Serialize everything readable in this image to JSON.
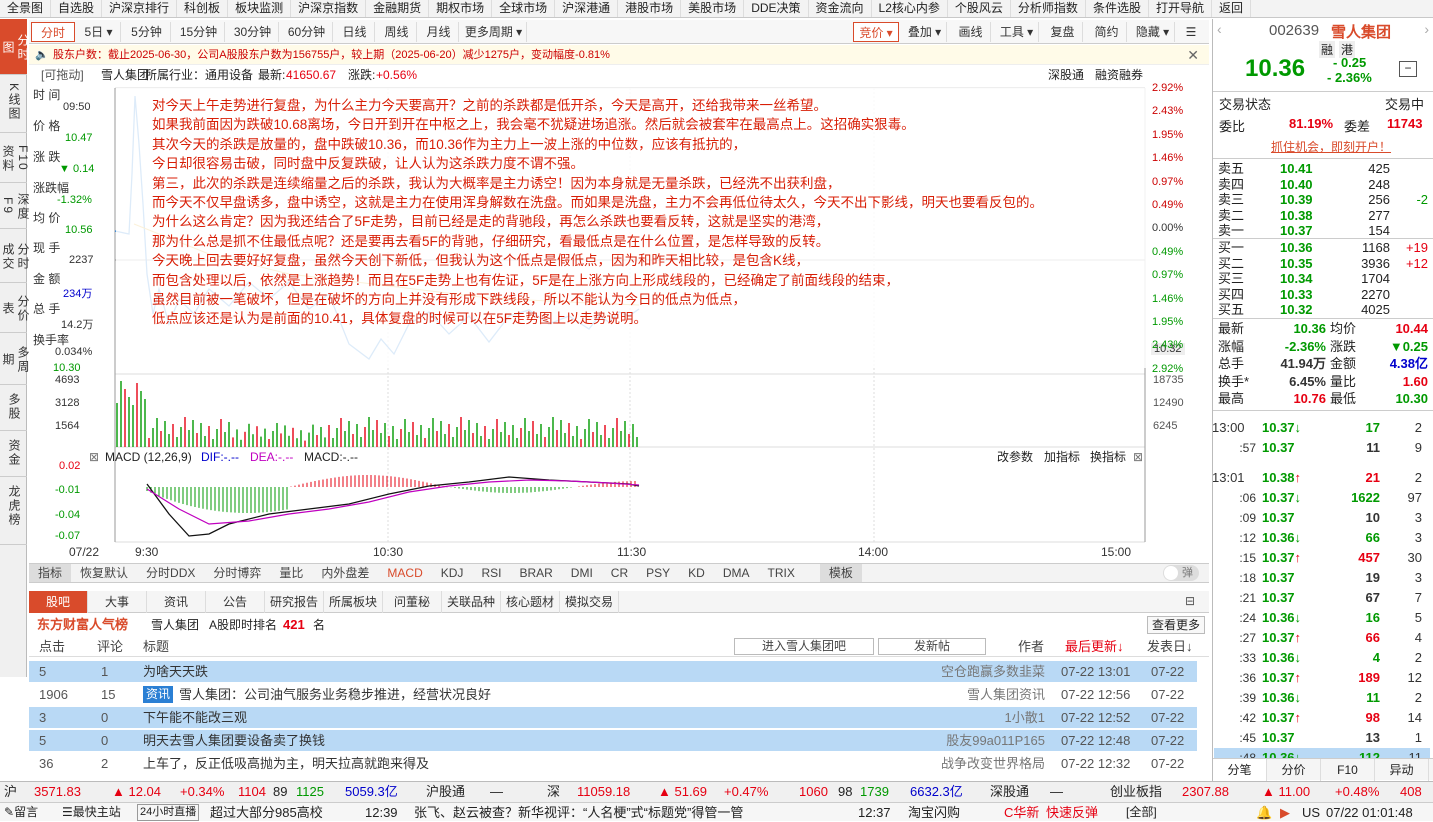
{
  "menu": [
    "全景图",
    "自选股",
    "沪深京排行",
    "科创板",
    "板块监测",
    "沪深京指数",
    "金融期货",
    "期权市场",
    "全球市场",
    "沪深港通",
    "港股市场",
    "美股市场",
    "DDE决策",
    "资金流向",
    "L2核心内参",
    "个股风云",
    "分析师指数",
    "条件选股",
    "打开导航",
    "返回"
  ],
  "left_tabs": [
    "分时图",
    "K线图",
    "F10资料",
    "深度F9",
    "分时成交",
    "分价表",
    "多周期",
    "多股",
    "资金",
    "龙虎榜"
  ],
  "toolbar": {
    "tabs": [
      "分时",
      "5日",
      "5分钟",
      "15分钟",
      "30分钟",
      "60分钟",
      "日线",
      "周线",
      "月线",
      "更多周期"
    ],
    "right": [
      "竞价",
      "叠加",
      "画线",
      "工具",
      "复盘",
      "简约",
      "隐藏"
    ]
  },
  "notice": "股东户数：截止2025-06-30，公司A股股东户数为156755户，较上期（2025-06-20）减少1275户，变动幅度-0.81%",
  "info": {
    "drag": "[可拖动]",
    "name": "雪人集团",
    "industry": "所属行业：通用设备",
    "latest_label": "最新:",
    "latest": "41650.67",
    "chg_label": "涨跌:",
    "chg": "+0.56%",
    "links": [
      "深股通",
      "融资融券"
    ]
  },
  "left_labels": {
    "time": "时 间",
    "time_v": "09:50",
    "price": "价 格",
    "price_v": "10.47",
    "chg": "涨 跌",
    "chg_v": "▼ 0.14",
    "pct": "涨跌幅",
    "pct_v": "-1.32%",
    "avg": "均 价",
    "avg_v": "10.56",
    "vol": "现 手",
    "vol_v": "2237",
    "amt": "金 额",
    "amt_v": "234万",
    "total": "总 手",
    "total_v": "14.2万",
    "turn": "换手率",
    "turn_v": "0.034%",
    "low_v": "10.30"
  },
  "price_axis": [
    "2.92%",
    "2.43%",
    "1.95%",
    "1.46%",
    "0.97%",
    "0.49%",
    "0.00%",
    "0.49%",
    "0.97%",
    "1.46%",
    "1.95%",
    "2.43%",
    "2.92%"
  ],
  "price_right": "10.32",
  "vol_axis_left": [
    "4693",
    "3128",
    "1564"
  ],
  "vol_axis_right": [
    "18735",
    "12490",
    "6245"
  ],
  "macd": {
    "label": "MACD (12,26,9)",
    "dif": "DIF:-.--",
    "dea": "DEA:-.--",
    "macd": "MACD:-.--",
    "actions": [
      "改参数",
      "加指标",
      "换指标"
    ],
    "axis": [
      "0.02",
      "-0.01",
      "-0.04",
      "-0.07"
    ]
  },
  "time_axis": [
    "07/22",
    "9:30",
    "10:30",
    "11:30",
    "14:00",
    "15:00"
  ],
  "annotation": [
    "对今天上午走势进行复盘，为什么主力今天要高开？之前的杀跌都是低开杀，今天是高开，还给我带来一丝希望。",
    "如果我前面因为跌破10.68离场，今日开到开在中枢之上，我会毫不犹疑进场追涨。然后就会被套牢在最高点上。这招确实狠毒。",
    "其次今天的杀跌是放量的，盘中跌破10.36，而10.36作为主力上一波上涨的中位数，应该有抵抗的，",
    "今日却很容易击破，同时盘中反复跌破，让人认为这杀跌力度不谓不强。",
    "第三，此次的杀跌是连续缩量之后的杀跌，我认为大概率是主力诱空！因为本身就是无量杀跌，已经洗不出获利盘，",
    "而今天不仅早盘诱多，盘中诱空，这就是主力在使用浑身解数在洗盘。而如果是洗盘，主力不会再低位待太久，今天不出下影线，明天也要看反包的。",
    "为什么这么肯定？因为我还结合了5F走势，目前已经是走的背驰段，再怎么杀跌也要看反转，这就是坚实的港湾，",
    "那为什么总是抓不住最低点呢？还是要再去看5F的背驰，仔细研究，看最低点是在什么位置，是怎样导致的反转。",
    "今天晚上回去要好好复盘，虽然今天创下新低，但我认为这个低点是假低点，因为和昨天相比较，是包含K线，",
    "而包含处理以后，依然是上涨趋势！而且在5F走势上也有佐证，5F是在上涨方向上形成线段的，已经确定了前面线段的结束，",
    "虽然目前被一笔破坏，但是在破坏的方向上并没有形成下跌线段，所以不能认为今日的低点为低点，",
    "低点应该还是认为是前面的10.41，具体复盘的时候可以在5F走势图上以走势说明。"
  ],
  "indicators": [
    "指标",
    "恢复默认",
    "分时DDX",
    "分时博弈",
    "量比",
    "内外盘差",
    "MACD",
    "KDJ",
    "RSI",
    "BRAR",
    "DMI",
    "CR",
    "PSY",
    "KD",
    "DMA",
    "TRIX",
    "模板"
  ],
  "toggle": "弹",
  "bottom_tabs": [
    "股吧",
    "大事",
    "资讯",
    "公告",
    "研究报告",
    "所属板块",
    "问董秘",
    "关联品种",
    "核心题材",
    "模拟交易"
  ],
  "popularity": {
    "title": "东方财富人气榜",
    "name": "雪人集团",
    "rank_label": "A股即时排名",
    "rank": "421",
    "unit": "名",
    "more": "查看更多"
  },
  "list_header": {
    "clicks": "点击",
    "comments": "评论",
    "title": "标题",
    "enter_btn": "进入雪人集团吧",
    "post_btn": "发新帖",
    "author": "作者",
    "last": "最后更新↓",
    "posted": "发表日↓"
  },
  "posts": [
    {
      "clicks": "5",
      "comments": "1",
      "tag": "",
      "title": "为啥天天跌",
      "author": "空仓跑赢多数韭菜",
      "last": "07-22 13:01",
      "posted": "07-22",
      "sel": true
    },
    {
      "clicks": "1906",
      "comments": "15",
      "tag": "资讯",
      "title": "雪人集团：公司油气服务业务稳步推进，经营状况良好",
      "author": "雪人集团资讯",
      "last": "07-22 12:56",
      "posted": "07-22",
      "sel": false
    },
    {
      "clicks": "3",
      "comments": "0",
      "tag": "",
      "title": "下午能不能改三观",
      "author": "1小散1",
      "last": "07-22 12:52",
      "posted": "07-22",
      "sel": true
    },
    {
      "clicks": "5",
      "comments": "0",
      "tag": "",
      "title": "明天去雪人集团要设备卖了换钱",
      "author": "股友99a011P165",
      "last": "07-22 12:48",
      "posted": "07-22",
      "sel": true
    },
    {
      "clicks": "36",
      "comments": "2",
      "tag": "",
      "title": "上车了，反正低吸高抛为主，明天拉高就跑来得及",
      "author": "战争改变世界格局",
      "last": "07-22 12:32",
      "posted": "07-22",
      "sel": false
    }
  ],
  "status": {
    "sh": "沪",
    "sh_v": "3571.83",
    "sh_c": "▲ 12.04",
    "sh_p": "+0.34%",
    "sh_n1": "1104",
    "sh_n2": "89",
    "sh_n3": "1125",
    "sh_amt": "5059.3亿",
    "hgt": "沪股通",
    "hgt_v": "—",
    "sz": "深",
    "sz_v": "11059.18",
    "sz_c": "▲ 51.69",
    "sz_p": "+0.47%",
    "sz_n1": "1060",
    "sz_n2": "98",
    "sz_n3": "1739",
    "sz_amt": "6632.3亿",
    "sgt": "深股通",
    "sgt_v": "—",
    "cy": "创业板指",
    "cy_v": "2307.88",
    "cy_c": "▲ 11.00",
    "cy_p": "+0.48%",
    "cy_n": "408"
  },
  "news": {
    "msg": "留言",
    "first": "最快主站",
    "h24": "24小时直播",
    "n1": "超过大部分985高校",
    "t1": "12:39",
    "n2": "张飞、赵云被查？新华视评：“人名梗”式“标题党”得管一管",
    "t2": "12:37",
    "n3": "淘宝闪购",
    "brand": "C华新",
    "quick": "快速反弹",
    "all": "[全部]",
    "region": "US",
    "time": "07/22 01:01:48"
  },
  "quote": {
    "code": "002639",
    "name": "雪人集团",
    "tags": [
      "融",
      "港"
    ],
    "price": "10.36",
    "chg": "- 0.25",
    "pct": "- 2.36%",
    "state_label": "交易状态",
    "state": "交易中",
    "wb_label": "委比",
    "wb": "81.19%",
    "wc_label": "委差",
    "wc": "11743",
    "promo": "抓住机会，即刻开户！"
  },
  "asks": [
    {
      "l": "卖五",
      "p": "10.41",
      "v": "425",
      "d": ""
    },
    {
      "l": "卖四",
      "p": "10.40",
      "v": "248",
      "d": ""
    },
    {
      "l": "卖三",
      "p": "10.39",
      "v": "256",
      "d": "-2"
    },
    {
      "l": "卖二",
      "p": "10.38",
      "v": "277",
      "d": ""
    },
    {
      "l": "卖一",
      "p": "10.37",
      "v": "154",
      "d": ""
    }
  ],
  "bids": [
    {
      "l": "买一",
      "p": "10.36",
      "v": "1168",
      "d": "+19"
    },
    {
      "l": "买二",
      "p": "10.35",
      "v": "3936",
      "d": "+12"
    },
    {
      "l": "买三",
      "p": "10.34",
      "v": "1704",
      "d": ""
    },
    {
      "l": "买四",
      "p": "10.33",
      "v": "2270",
      "d": ""
    },
    {
      "l": "买五",
      "p": "10.32",
      "v": "4025",
      "d": ""
    }
  ],
  "stats": [
    [
      "最新",
      "10.36",
      "均价",
      "10.44"
    ],
    [
      "涨幅",
      "-2.36%",
      "涨跌",
      "▼0.25"
    ],
    [
      "总手",
      "41.94万",
      "金额",
      "4.38亿"
    ],
    [
      "换手*",
      "6.45%",
      "量比",
      "1.60"
    ],
    [
      "最高",
      "10.76",
      "最低",
      "10.30"
    ]
  ],
  "ticks": [
    [
      "13:00",
      "10.37",
      "↓",
      "17",
      "2"
    ],
    [
      ":57",
      "10.37",
      "",
      "11",
      "9"
    ],
    [
      "13:01",
      "10.38",
      "↑",
      "21",
      "2"
    ],
    [
      ":06",
      "10.37",
      "↓",
      "1622",
      "97"
    ],
    [
      ":09",
      "10.37",
      "",
      "10",
      "3"
    ],
    [
      ":12",
      "10.36",
      "↓",
      "66",
      "3"
    ],
    [
      ":15",
      "10.37",
      "↑",
      "457",
      "30"
    ],
    [
      ":18",
      "10.37",
      "",
      "19",
      "3"
    ],
    [
      ":21",
      "10.37",
      "",
      "67",
      "7"
    ],
    [
      ":24",
      "10.36",
      "↓",
      "16",
      "5"
    ],
    [
      ":27",
      "10.37",
      "↑",
      "66",
      "4"
    ],
    [
      ":33",
      "10.36",
      "↓",
      "4",
      "2"
    ],
    [
      ":36",
      "10.37",
      "↑",
      "189",
      "12"
    ],
    [
      ":39",
      "10.36",
      "↓",
      "11",
      "2"
    ],
    [
      ":42",
      "10.37",
      "↑",
      "98",
      "14"
    ],
    [
      ":45",
      "10.37",
      "",
      "13",
      "1"
    ],
    [
      ":48",
      "10.36",
      "↓",
      "112",
      "11"
    ]
  ],
  "rp_tabs": [
    "分笔",
    "分价",
    "F10",
    "异动"
  ]
}
